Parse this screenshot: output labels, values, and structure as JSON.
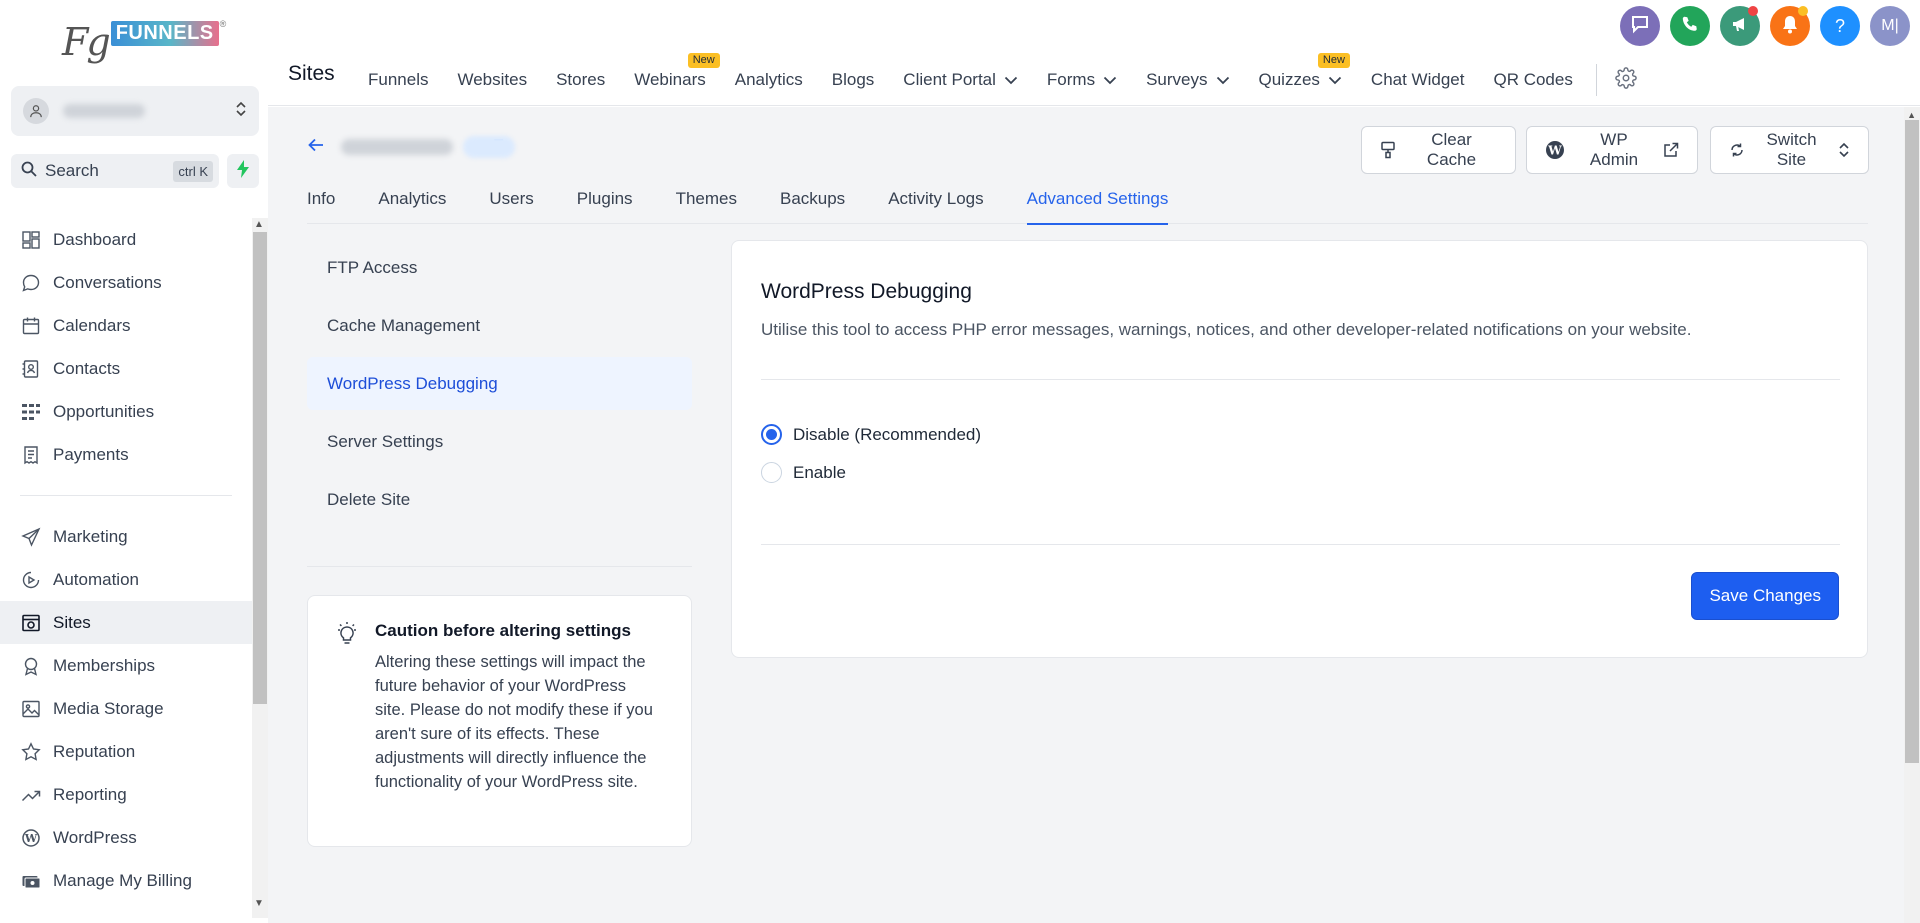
{
  "brand": {
    "logo_prefix": "Fg",
    "logo_word": "FUNNELS",
    "logo_mark": "®"
  },
  "sidebar": {
    "search_label": "Search",
    "search_shortcut": "ctrl K",
    "items": [
      {
        "label": "Dashboard",
        "icon": "dashboard-icon"
      },
      {
        "label": "Conversations",
        "icon": "chat-bubble-icon"
      },
      {
        "label": "Calendars",
        "icon": "calendar-icon"
      },
      {
        "label": "Contacts",
        "icon": "contacts-icon"
      },
      {
        "label": "Opportunities",
        "icon": "opportunities-icon"
      },
      {
        "label": "Payments",
        "icon": "receipt-icon"
      }
    ],
    "items2": [
      {
        "label": "Marketing",
        "icon": "send-icon"
      },
      {
        "label": "Automation",
        "icon": "automation-icon"
      },
      {
        "label": "Sites",
        "icon": "sites-icon",
        "active": true
      },
      {
        "label": "Memberships",
        "icon": "award-icon"
      },
      {
        "label": "Media Storage",
        "icon": "image-icon"
      },
      {
        "label": "Reputation",
        "icon": "star-icon"
      },
      {
        "label": "Reporting",
        "icon": "trend-icon"
      },
      {
        "label": "WordPress",
        "icon": "wordpress-icon"
      },
      {
        "label": "Manage My Billing",
        "icon": "billing-icon"
      }
    ]
  },
  "topbar": {
    "title": "Sites",
    "links": [
      {
        "label": "Funnels"
      },
      {
        "label": "Websites"
      },
      {
        "label": "Stores"
      },
      {
        "label": "Webinars",
        "badge": "New"
      },
      {
        "label": "Analytics"
      },
      {
        "label": "Blogs"
      },
      {
        "label": "Client Portal",
        "dropdown": true
      },
      {
        "label": "Forms",
        "dropdown": true
      },
      {
        "label": "Surveys",
        "dropdown": true
      },
      {
        "label": "Quizzes",
        "dropdown": true,
        "badge": "New"
      },
      {
        "label": "Chat Widget"
      },
      {
        "label": "QR Codes"
      }
    ],
    "avatar_initials": "M|",
    "help_glyph": "?"
  },
  "site_actions": {
    "clear_cache": "Clear Cache",
    "wp_admin": "WP Admin",
    "switch_site": "Switch Site"
  },
  "tabs": [
    {
      "label": "Info"
    },
    {
      "label": "Analytics"
    },
    {
      "label": "Users"
    },
    {
      "label": "Plugins"
    },
    {
      "label": "Themes"
    },
    {
      "label": "Backups"
    },
    {
      "label": "Activity Logs"
    },
    {
      "label": "Advanced Settings",
      "active": true
    }
  ],
  "subnav": [
    {
      "label": "FTP Access"
    },
    {
      "label": "Cache Management"
    },
    {
      "label": "WordPress Debugging",
      "active": true
    },
    {
      "label": "Server Settings"
    },
    {
      "label": "Delete Site"
    }
  ],
  "caution": {
    "title": "Caution before altering settings",
    "body": "Altering these settings will impact the future behavior of your WordPress site. Please do not modify these if you aren't sure of its effects. These adjustments will directly influence the functionality of your WordPress site."
  },
  "panel": {
    "title": "WordPress Debugging",
    "description": "Utilise this tool to access PHP error messages, warnings, notices, and other developer-related notifications on your website.",
    "options": [
      {
        "label": "Disable (Recommended)",
        "checked": true
      },
      {
        "label": "Enable",
        "checked": false
      }
    ],
    "save_label": "Save Changes"
  },
  "colors": {
    "accent": "#2563eb",
    "save_button": "#1d5ef0",
    "badge_new": "#fbbf24",
    "chat_circle": "#7c6fb8",
    "phone_circle": "#22a55a",
    "megaphone_circle": "#3b9a7a",
    "bell_circle": "#f97316",
    "help_circle": "#1e90ff",
    "avatar_circle": "#8b93c9"
  }
}
